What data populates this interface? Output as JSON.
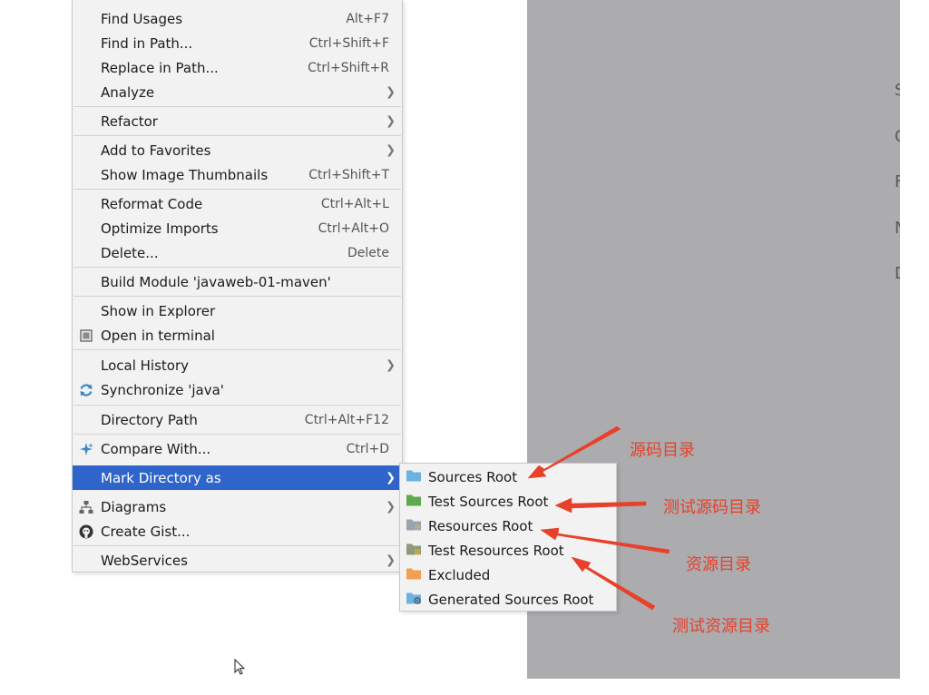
{
  "context_menu": {
    "items": [
      {
        "label": "Find Usages",
        "shortcut": "Alt+F7"
      },
      {
        "label": "Find in Path...",
        "shortcut": "Ctrl+Shift+F"
      },
      {
        "label": "Replace in Path...",
        "shortcut": "Ctrl+Shift+R"
      },
      {
        "label": "Analyze"
      },
      {
        "label": "Refactor"
      },
      {
        "label": "Add to Favorites"
      },
      {
        "label": "Show Image Thumbnails",
        "shortcut": "Ctrl+Shift+T"
      },
      {
        "label": "Reformat Code",
        "shortcut": "Ctrl+Alt+L"
      },
      {
        "label": "Optimize Imports",
        "shortcut": "Ctrl+Alt+O"
      },
      {
        "label": "Delete...",
        "shortcut": "Delete"
      },
      {
        "label": "Build Module 'javaweb-01-maven'"
      },
      {
        "label": "Show in Explorer"
      },
      {
        "label": "Open in terminal",
        "icon": "terminal-icon"
      },
      {
        "label": "Local History"
      },
      {
        "label": "Synchronize 'java'",
        "icon": "sync-icon"
      },
      {
        "label": "Directory Path",
        "shortcut": "Ctrl+Alt+F12"
      },
      {
        "label": "Compare With...",
        "shortcut": "Ctrl+D",
        "icon": "compare-icon"
      },
      {
        "label": "Mark Directory as",
        "selected": true
      },
      {
        "label": "Diagrams",
        "icon": "diagram-icon"
      },
      {
        "label": "Create Gist...",
        "icon": "github-icon"
      },
      {
        "label": "WebServices"
      }
    ]
  },
  "submenu": {
    "items": [
      {
        "label": "Sources Root",
        "icon": "sources-root-folder-icon",
        "color": "#6bb2e0"
      },
      {
        "label": "Test Sources Root",
        "icon": "test-sources-root-folder-icon",
        "color": "#5fa84f"
      },
      {
        "label": "Resources Root",
        "icon": "resources-root-folder-icon",
        "color": "#9aa3b1"
      },
      {
        "label": "Test Resources Root",
        "icon": "test-resources-root-folder-icon",
        "color": "#8d9a7b"
      },
      {
        "label": "Excluded",
        "icon": "excluded-folder-icon",
        "color": "#f0a050"
      },
      {
        "label": "Generated Sources Root",
        "icon": "generated-sources-root-folder-icon",
        "color": "#6bb2e0"
      }
    ]
  },
  "annotations": [
    {
      "text": "源码目录"
    },
    {
      "text": "测试源码目录"
    },
    {
      "text": "资源目录"
    },
    {
      "text": "测试资源目录"
    }
  ],
  "background_panel": {
    "letters": [
      "S",
      "C",
      "F",
      "N",
      "D"
    ]
  },
  "colors": {
    "selection": "#2f65ca",
    "annotation_red": "#e8402a"
  }
}
